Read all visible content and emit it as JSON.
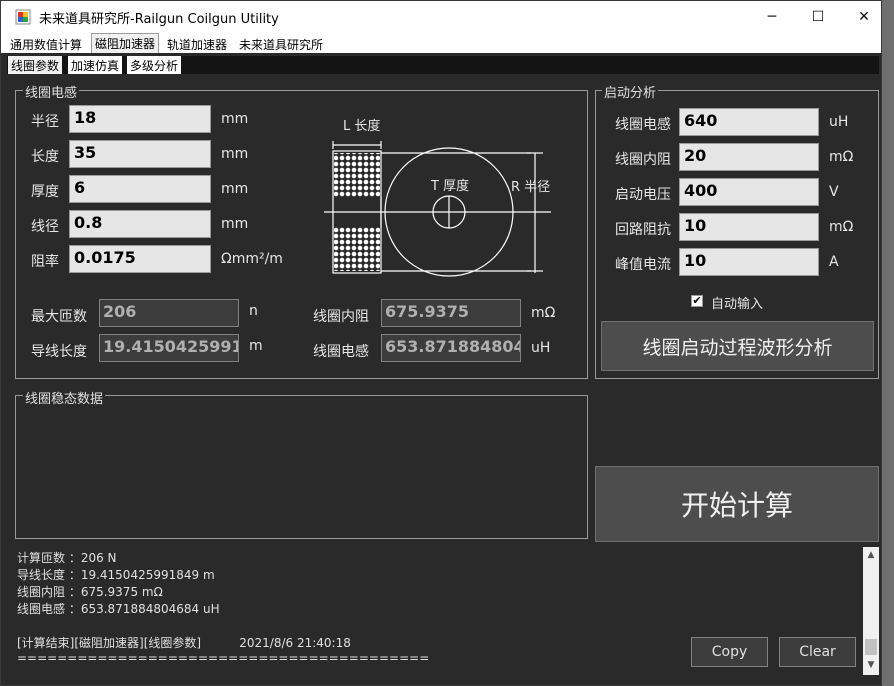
{
  "window": {
    "title": "未来道具研究所-Railgun Coilgun Utility",
    "minimize": "─",
    "maximize": "☐",
    "close": "✕"
  },
  "tabs": [
    "通用数值计算",
    "磁阻加速器",
    "轨道加速器",
    "未来道具研究所"
  ],
  "subtabs": [
    "线圈参数",
    "加速仿真",
    "多级分析"
  ],
  "inductance_group": {
    "title": "线圈电感",
    "fields": [
      {
        "label": "半径",
        "value": "18",
        "unit": "mm"
      },
      {
        "label": "长度",
        "value": "35",
        "unit": "mm"
      },
      {
        "label": "厚度",
        "value": "6",
        "unit": "mm"
      },
      {
        "label": "线径",
        "value": "0.8",
        "unit": "mm"
      },
      {
        "label": "阻率",
        "value": "0.0175",
        "unit": "Ωmm²/m"
      }
    ],
    "diagram": {
      "length_label": "L 长度",
      "thickness_label": "T 厚度",
      "radius_label": "R 半径"
    },
    "outputs": [
      {
        "label": "最大匝数",
        "value": "206",
        "unit": "n"
      },
      {
        "label": "导线长度",
        "value": "19.41504259918",
        "unit": "m"
      },
      {
        "label": "线圈内阻",
        "value": "675.9375",
        "unit": "mΩ"
      },
      {
        "label": "线圈电感",
        "value": "653.8718848046",
        "unit": "uH"
      }
    ]
  },
  "startup_group": {
    "title": "启动分析",
    "fields": [
      {
        "label": "线圈电感",
        "value": "640",
        "unit": "uH"
      },
      {
        "label": "线圈内阻",
        "value": "20",
        "unit": "mΩ"
      },
      {
        "label": "启动电压",
        "value": "400",
        "unit": "V"
      },
      {
        "label": "回路阻抗",
        "value": "10",
        "unit": "mΩ"
      },
      {
        "label": "峰值电流",
        "value": "10",
        "unit": "A"
      }
    ],
    "auto_input_label": "自动输入",
    "waveform_button": "线圈启动过程波形分析"
  },
  "steady_group": {
    "title": "线圈稳态数据"
  },
  "start_button": "开始计算",
  "log": {
    "lines": [
      "计算匝数 ：206 N",
      "导线长度 ：19.4150425991849 m",
      "线圈内阻 ：675.9375 mΩ",
      "线圈电感 ：653.871884804684 uH",
      "",
      "[计算结束][磁阻加速器][线圈参数]          2021/8/6 21:40:18",
      "========================================="
    ],
    "copy": "Copy",
    "clear": "Clear"
  },
  "colors": {
    "accent": "#2a2a2a",
    "field_bg": "#e6e6e6"
  },
  "scrollbar": {
    "up": "▲",
    "down": "▼"
  }
}
